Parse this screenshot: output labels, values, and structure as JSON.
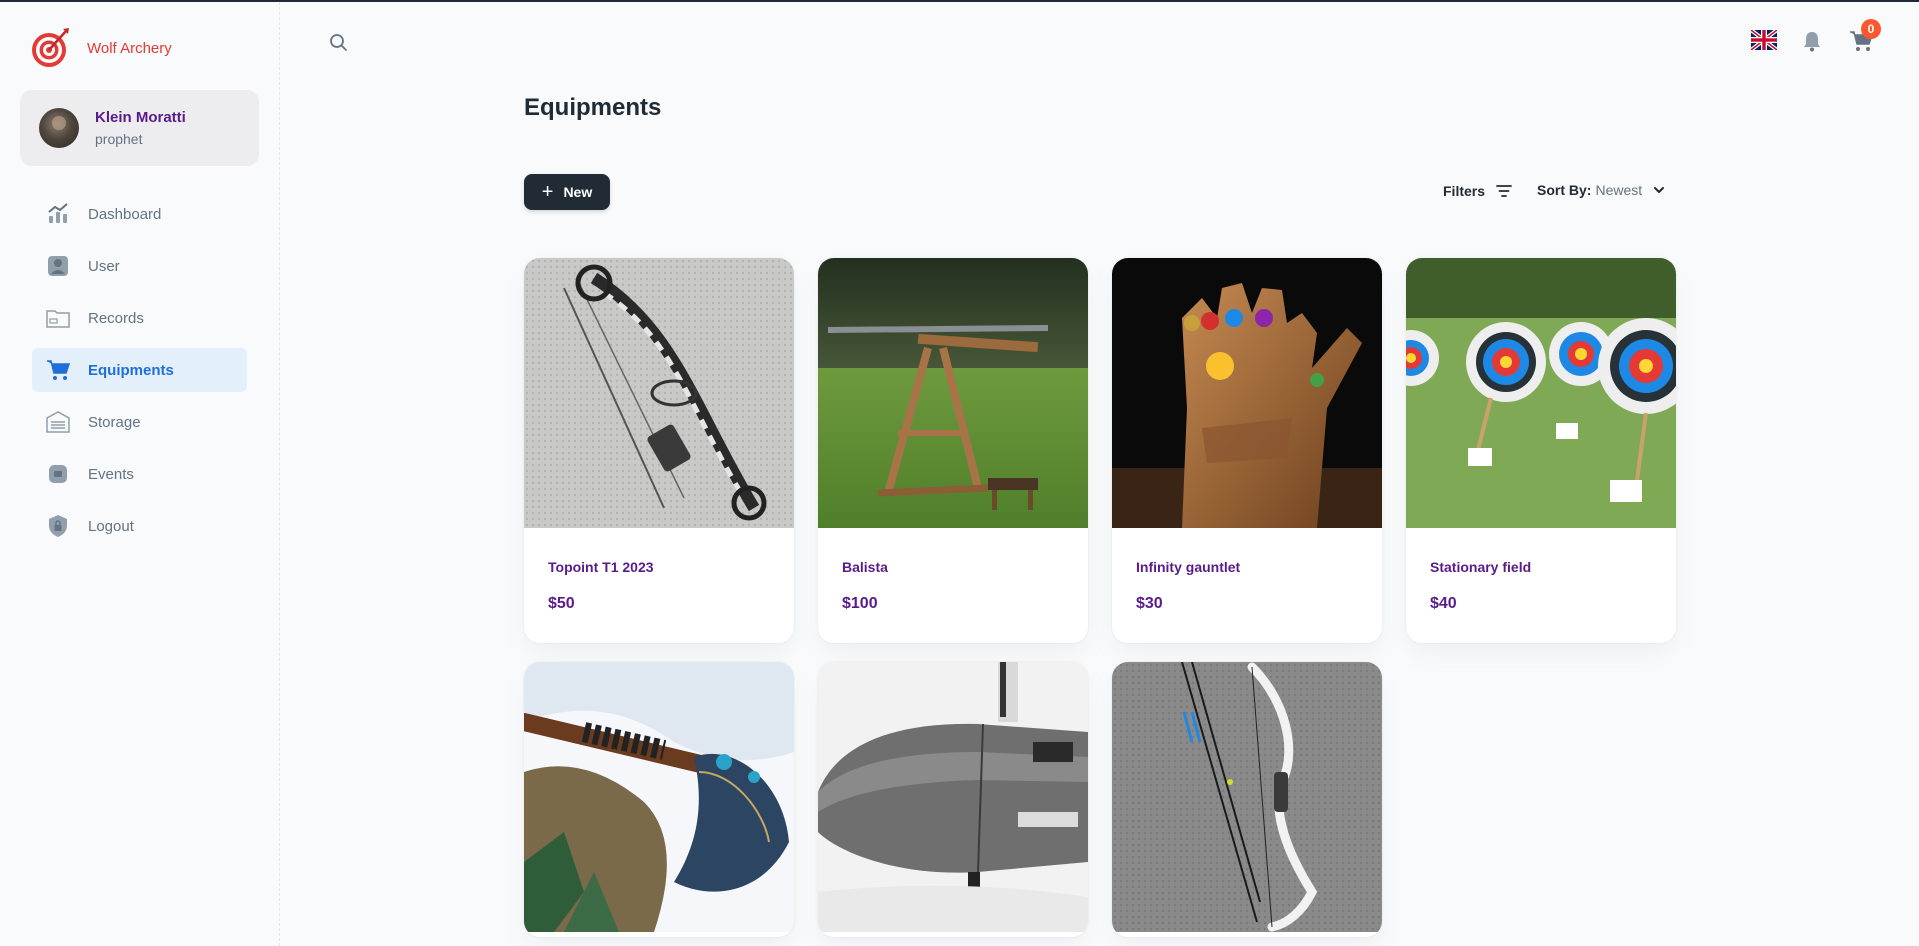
{
  "brand": {
    "name": "Wolf Archery",
    "logo_icon": "archery-target-icon",
    "color": "#e53935"
  },
  "account": {
    "name": "Klein Moratti",
    "role": "prophet"
  },
  "nav": {
    "items": [
      {
        "label": "Dashboard",
        "icon": "chart-icon",
        "active": false
      },
      {
        "label": "User",
        "icon": "user-icon",
        "active": false
      },
      {
        "label": "Records",
        "icon": "folder-icon",
        "active": false
      },
      {
        "label": "Equipments",
        "icon": "cart-icon",
        "active": true
      },
      {
        "label": "Storage",
        "icon": "warehouse-icon",
        "active": false
      },
      {
        "label": "Events",
        "icon": "calendar-icon",
        "active": false
      },
      {
        "label": "Logout",
        "icon": "lock-icon",
        "active": false
      }
    ]
  },
  "header": {
    "cart_count": "0",
    "language": "English (UK)"
  },
  "main": {
    "title": "Equipments",
    "new_label": "New",
    "filters_label": "Filters",
    "sort_label": "Sort By:",
    "sort_value": "Newest"
  },
  "products": [
    {
      "name": "Topoint T1 2023",
      "price": "$50",
      "image": "compound bow"
    },
    {
      "name": "Balista",
      "price": "$100",
      "image": "ballista"
    },
    {
      "name": "Infinity gauntlet",
      "price": "$30",
      "image": "gauntlet"
    },
    {
      "name": "Stationary field",
      "price": "$40",
      "image": "archery targets"
    },
    {
      "name": "",
      "price": "",
      "image": "axe in snow"
    },
    {
      "name": "",
      "price": "",
      "image": "bomb"
    },
    {
      "name": "",
      "price": "",
      "image": "recurve bow"
    }
  ],
  "colors": {
    "accent": "#1e6fd9",
    "product_text": "#5a1b8a",
    "badge": "#ff5630",
    "dark": "#212b36"
  }
}
